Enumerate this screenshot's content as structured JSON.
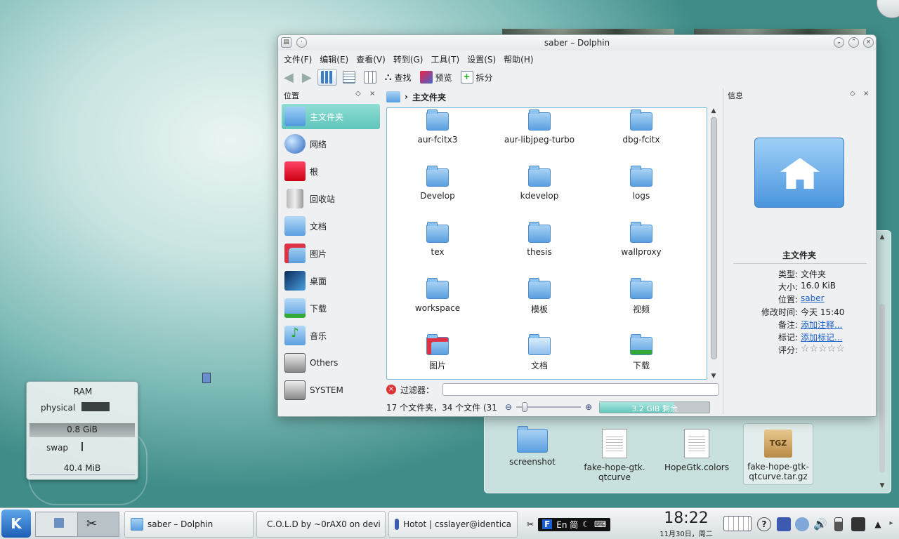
{
  "window": {
    "title": "saber – Dolphin",
    "menu": [
      "文件(F)",
      "编辑(E)",
      "查看(V)",
      "转到(G)",
      "工具(T)",
      "设置(S)",
      "帮助(H)"
    ],
    "toolbar": {
      "find": "查找",
      "preview": "预览",
      "split": "拆分"
    }
  },
  "places": {
    "title": "位置",
    "items": [
      "主文件夹",
      "网络",
      "根",
      "回收站",
      "文档",
      "图片",
      "桌面",
      "下载",
      "音乐",
      "Others",
      "SYSTEM"
    ]
  },
  "breadcrumb": "主文件夹",
  "files": [
    "aur-fcitx3",
    "aur-libjpeg-turbo",
    "dbg-fcitx",
    "Develop",
    "kdevelop",
    "logs",
    "tex",
    "thesis",
    "wallproxy",
    "workspace",
    "模板",
    "视频",
    "图片",
    "文档",
    "下载"
  ],
  "filter_label": "过滤器：",
  "status": {
    "text": "17 个文件夹，34 个文件 (31",
    "free": "3.2 GiB 剩余",
    "free_fraction": 0.68
  },
  "info": {
    "title": "信息",
    "name": "主文件夹",
    "rows": [
      {
        "k": "类型:",
        "v": "文件夹"
      },
      {
        "k": "大小:",
        "v": "16.0 KiB"
      },
      {
        "k": "位置:",
        "v": "saber"
      },
      {
        "k": "修改时间:",
        "v": "今天 15:40"
      },
      {
        "k": "备注:",
        "v": "添加注释..."
      },
      {
        "k": "标记:",
        "v": "添加标记..."
      },
      {
        "k": "评分:",
        "v": "☆☆☆☆☆"
      }
    ]
  },
  "ram": {
    "title": "RAM",
    "physical": "physical",
    "physical_value": "0.8 GiB",
    "swap": "swap",
    "swap_value": "40.4 MiB"
  },
  "desktop_files": [
    "screenshot",
    "fake-hope-gtk.\nqtcurve",
    "HopeGtk.colors",
    "fake-hope-gtk-\nqtcurve.tar.gz"
  ],
  "desktop_badge": "TGZ",
  "taskbar": {
    "tasks": [
      "saber – Dolphin",
      "C.O.L.D by ~0rAX0 on devi",
      "Hotot | csslayer@identica"
    ],
    "ime": "En 简",
    "clock_time": "18:22",
    "clock_date": "11月30日，周二"
  }
}
